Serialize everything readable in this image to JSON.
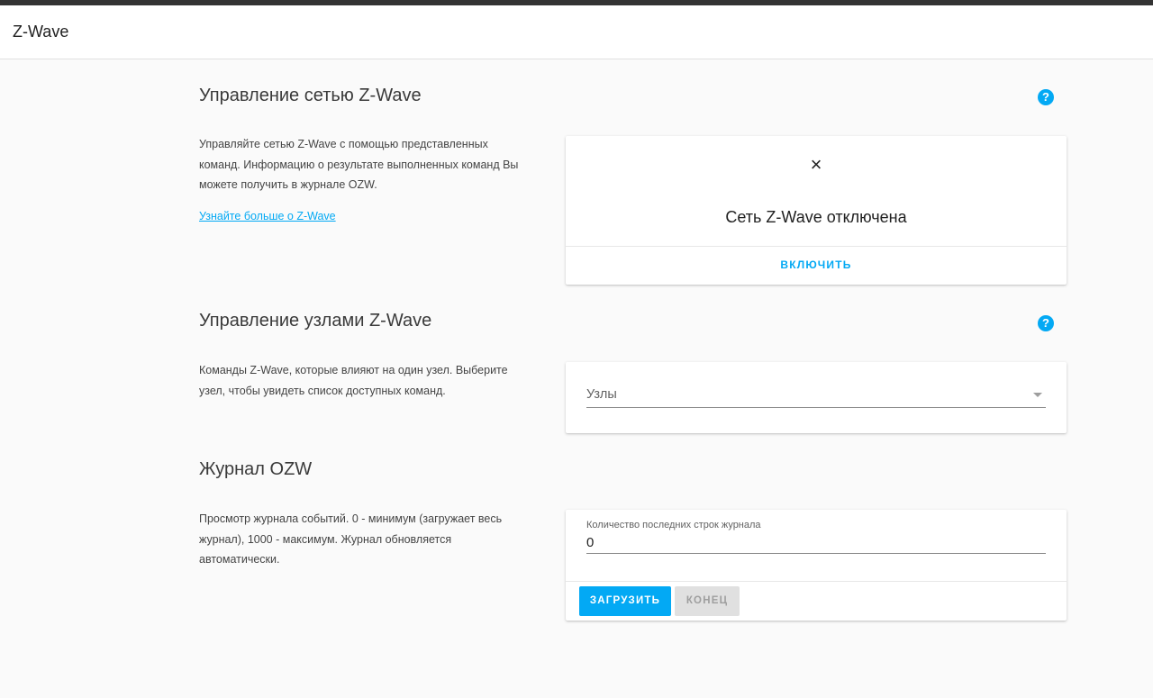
{
  "appbar": {
    "title": "Z-Wave"
  },
  "network": {
    "title": "Управление сетью Z-Wave",
    "description": "Управляйте сетью Z-Wave с помощью представленных команд. Информацию о результате выполненных команд Вы можете получить в журнале OZW.",
    "link": "Узнайте больше о Z-Wave",
    "help_icon": "?",
    "close_icon": "×",
    "status": "Сеть Z-Wave отключена",
    "action": "ВКЛЮЧИТЬ"
  },
  "nodes": {
    "title": "Управление узлами Z-Wave",
    "description": "Команды Z-Wave, которые влияют на один узел. Выберите узел, чтобы увидеть список доступных команд.",
    "help_icon": "?",
    "select_label": "Узлы"
  },
  "log": {
    "title": "Журнал OZW",
    "description": "Просмотр журнала событий. 0 - минимум (загружает весь журнал), 1000 - максимум. Журнал обновляется автоматически.",
    "input_label": "Количество последних строк журнала",
    "input_value": "0",
    "load_button": "ЗАГРУЗИТЬ",
    "end_button": "КОНЕЦ"
  },
  "colors": {
    "accent": "#03a9f4",
    "disabled": "#e0e0e0"
  }
}
